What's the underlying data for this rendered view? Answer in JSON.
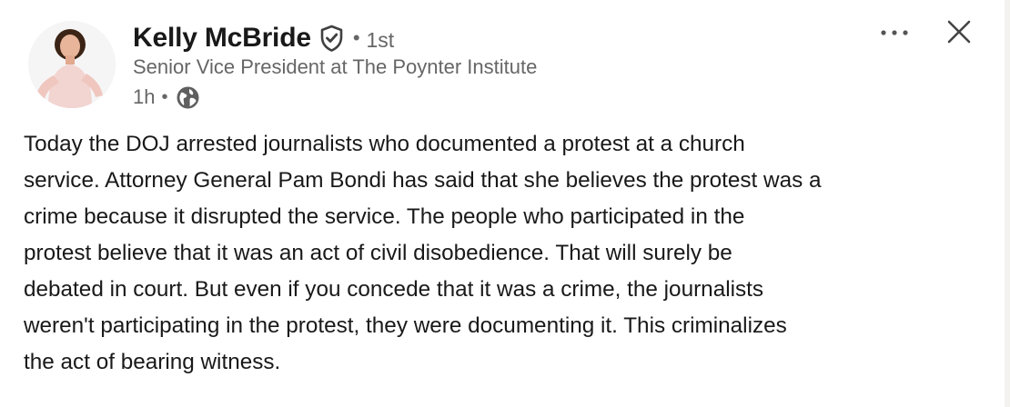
{
  "post": {
    "author": {
      "name": "Kelly McBride",
      "connection_degree": "1st",
      "headline": "Senior Vice President at The Poynter Institute",
      "verified_icon": "verified-shield-icon",
      "avatar": "profile-photo"
    },
    "timestamp": "1h",
    "visibility_icon": "globe-icon",
    "text_lines": [
      "Today the DOJ arrested journalists who documented a protest at a church",
      "service. Attorney General Pam Bondi has said that she believes the protest was a",
      "crime because it disrupted the service. The people who participated in the",
      "protest believe that it was an act of civil disobedience. That will surely be",
      "debated in court. But even if you concede that it was a crime, the journalists",
      "weren't participating in the protest, they were documenting it. This criminalizes",
      "the act of bearing witness."
    ]
  },
  "controls": {
    "more_icon": "more-horizontal-icon",
    "close_icon": "close-icon"
  },
  "separators": {
    "dot": "•"
  },
  "colors": {
    "primary_text": "#191919",
    "secondary_text": "#666666",
    "background": "#ffffff"
  }
}
